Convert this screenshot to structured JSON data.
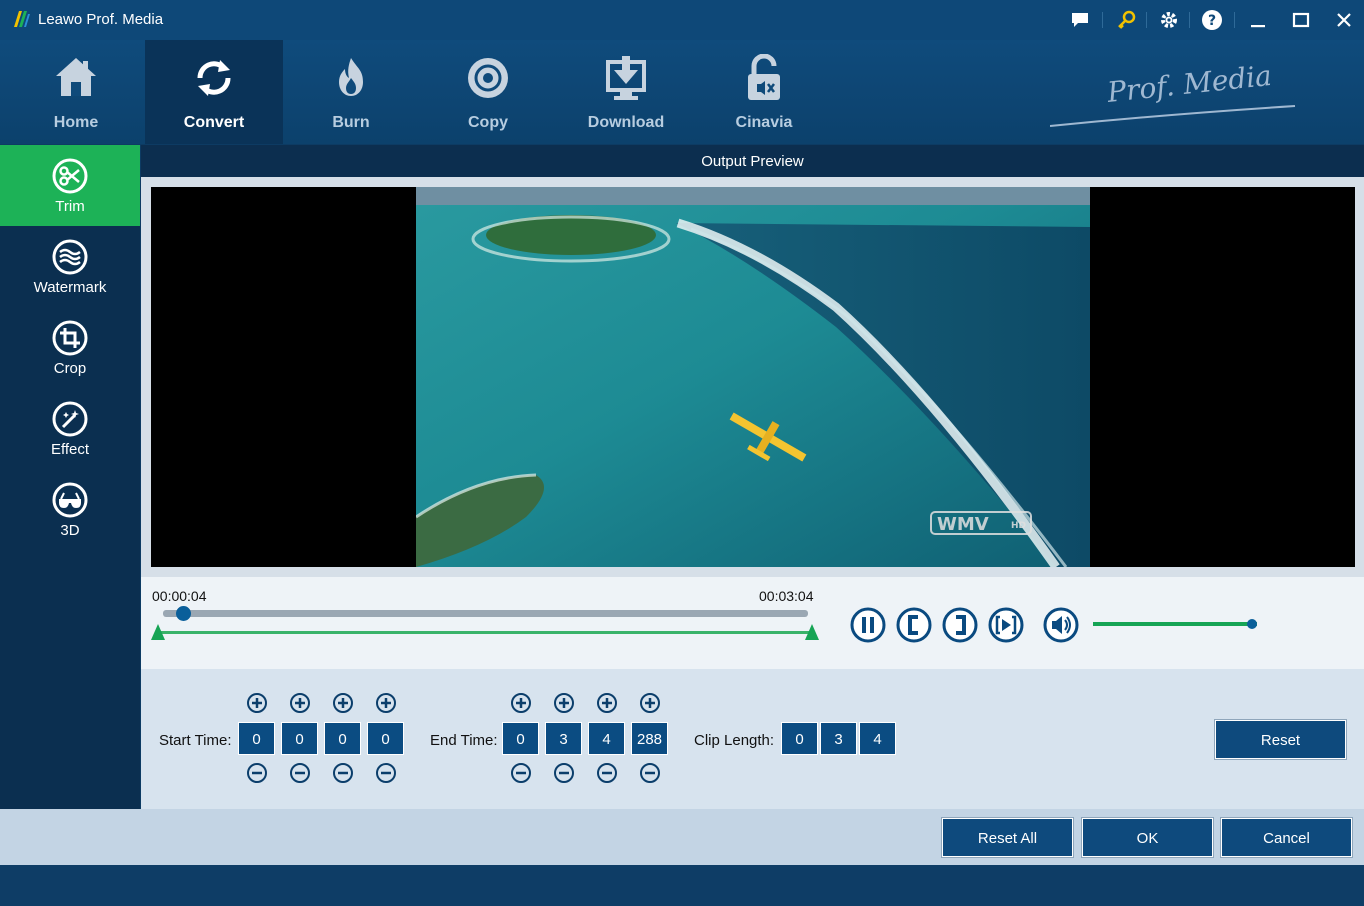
{
  "app": {
    "title": "Leawo Prof. Media"
  },
  "nav": {
    "items": [
      {
        "label": "Home"
      },
      {
        "label": "Convert"
      },
      {
        "label": "Burn"
      },
      {
        "label": "Copy"
      },
      {
        "label": "Download"
      },
      {
        "label": "Cinavia"
      }
    ],
    "active": "Convert"
  },
  "sidebar": {
    "items": [
      {
        "label": "Trim"
      },
      {
        "label": "Watermark"
      },
      {
        "label": "Crop"
      },
      {
        "label": "Effect"
      },
      {
        "label": "3D"
      }
    ],
    "active": "Trim"
  },
  "preview": {
    "header": "Output Preview",
    "current_time": "00:00:04",
    "end_time": "00:03:04",
    "progress_fraction": 0.02,
    "volume_fraction": 0.97
  },
  "trim": {
    "start_label": "Start Time:",
    "start_values": [
      "0",
      "0",
      "0",
      "0"
    ],
    "end_label": "End Time:",
    "end_values": [
      "0",
      "3",
      "4",
      "288"
    ],
    "clip_label": "Clip Length:",
    "clip_values": [
      "0",
      "3",
      "4"
    ],
    "reset_label": "Reset"
  },
  "footer": {
    "reset_all_label": "Reset All",
    "ok_label": "OK",
    "cancel_label": "Cancel"
  },
  "colors": {
    "accent_green": "#1db257",
    "dark_blue": "#0b2f50",
    "button_blue": "#0e4a7d"
  }
}
